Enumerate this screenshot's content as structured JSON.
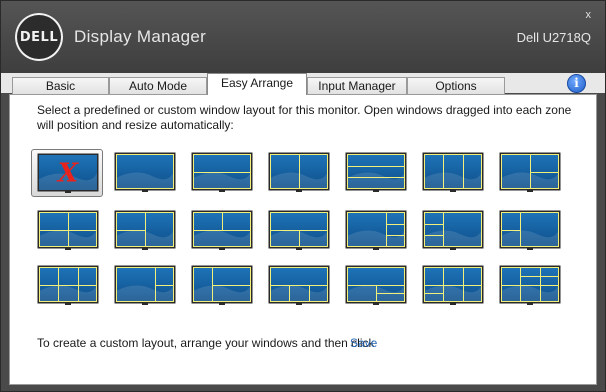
{
  "app": {
    "logo_text": "DELL",
    "title": "Display Manager",
    "monitor": "Dell U2718Q",
    "close_glyph": "x"
  },
  "tabs": [
    {
      "label": "Basic",
      "active": false
    },
    {
      "label": "Auto Mode",
      "active": false
    },
    {
      "label": "Easy Arrange",
      "active": true
    },
    {
      "label": "Input Manager",
      "active": false
    },
    {
      "label": "Options",
      "active": false
    }
  ],
  "info_icon": {
    "glyph": "i",
    "icon": "info-icon"
  },
  "main": {
    "instructions": "Select a predefined or custom window layout for this monitor.  Open windows dragged into each zone will position and resize automatically:",
    "footer_text": "To create a custom layout, arrange your windows and then click",
    "save_link": "Save"
  },
  "layouts": [
    {
      "id": "none",
      "selected": true,
      "mark": "X",
      "zones": []
    },
    {
      "id": "full",
      "zones": []
    },
    {
      "id": "2-rows",
      "zones": [
        "h50"
      ]
    },
    {
      "id": "2-cols",
      "zones": [
        "v50"
      ]
    },
    {
      "id": "3-rows",
      "zones": [
        "h33",
        "h66"
      ]
    },
    {
      "id": "3-cols",
      "zones": [
        "v33",
        "v66"
      ]
    },
    {
      "id": "left-right-split",
      "zones": [
        "v50",
        "hR50"
      ]
    },
    {
      "id": "quad",
      "zones": [
        "v50",
        "h50"
      ]
    },
    {
      "id": "left-half-split",
      "zones": [
        "v50",
        "hL50"
      ]
    },
    {
      "id": "top-split",
      "zones": [
        "h50",
        "vT50"
      ]
    },
    {
      "id": "bottom-split",
      "zones": [
        "h50",
        "vB50"
      ]
    },
    {
      "id": "big-left-right-3",
      "zones": [
        "v66",
        "hR33",
        "hR66"
      ]
    },
    {
      "id": "left-3-big-right",
      "zones": [
        "v33",
        "hL33",
        "hL66"
      ]
    },
    {
      "id": "big-right-left-2",
      "zones": [
        "v33",
        "hL50"
      ]
    },
    {
      "id": "six-grid",
      "zones": [
        "v33",
        "v66",
        "h50"
      ]
    },
    {
      "id": "wide-left-right-2",
      "zones": [
        "v66",
        "hR50"
      ]
    },
    {
      "id": "narrow-left-right-2",
      "zones": [
        "v33",
        "hR50"
      ]
    },
    {
      "id": "top-bottom-3",
      "zones": [
        "h50",
        "vB33",
        "vB66"
      ]
    },
    {
      "id": "bottom-pair-right-3",
      "zones": [
        "h50",
        "vB50",
        "hR75"
      ]
    },
    {
      "id": "nine-grid-mix",
      "zones": [
        "v33",
        "v66",
        "h50",
        "hL75"
      ]
    },
    {
      "id": "eight-grid",
      "zones": [
        "v33",
        "v66",
        "h50",
        "hR25"
      ]
    }
  ],
  "colors": {
    "screen_top": "#1e74b8",
    "screen_bottom": "#0f4f8a",
    "zone_line": "#f2f07a",
    "bezel": "#2a2a2a",
    "x_mark": "#e8231e"
  }
}
